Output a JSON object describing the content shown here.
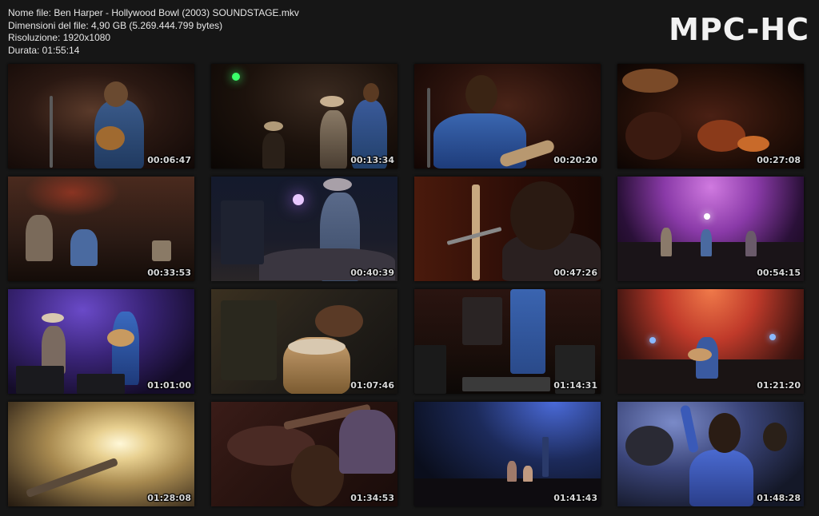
{
  "file_info": {
    "name_line": "Nome file: Ben Harper - Hollywood Bowl (2003) SOUNDSTAGE.mkv",
    "size_line": "Dimensioni del file: 4,90 GB (5.269.444.799 bytes)",
    "resolution_line": "Risoluzione: 1920x1080",
    "duration_line": "Durata: 01:55:14"
  },
  "brand": "MPC-HC",
  "thumbnails": [
    {
      "time": "00:06:47"
    },
    {
      "time": "00:13:34"
    },
    {
      "time": "00:20:20"
    },
    {
      "time": "00:27:08"
    },
    {
      "time": "00:33:53"
    },
    {
      "time": "00:40:39"
    },
    {
      "time": "00:47:26"
    },
    {
      "time": "00:54:15"
    },
    {
      "time": "01:01:00"
    },
    {
      "time": "01:07:46"
    },
    {
      "time": "01:14:31"
    },
    {
      "time": "01:21:20"
    },
    {
      "time": "01:28:08"
    },
    {
      "time": "01:34:53"
    },
    {
      "time": "01:41:43"
    },
    {
      "time": "01:48:28"
    }
  ]
}
